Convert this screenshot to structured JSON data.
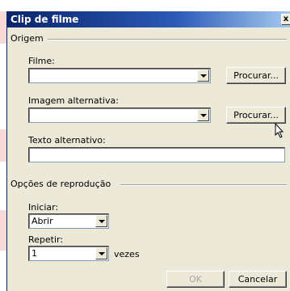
{
  "window": {
    "title": "Clip de filme",
    "close_glyph": "x"
  },
  "origem": {
    "group_label": "Origem",
    "filme_label": "Filme:",
    "filme_value": "",
    "procurar1_label": "Procurar...",
    "imagem_label": "Imagem alternativa:",
    "imagem_value": "",
    "procurar2_label": "Procurar...",
    "texto_label": "Texto alternativo:",
    "texto_value": ""
  },
  "reproducao": {
    "group_label": "Opções de reprodução",
    "iniciar_label": "Iniciar:",
    "iniciar_value": "Abrir",
    "repetir_label": "Repetir:",
    "repetir_value": "1",
    "vezes_label": "vezes"
  },
  "footer": {
    "ok_label": "OK",
    "cancel_label": "Cancelar"
  },
  "icons": {
    "close": "close-icon",
    "dropdown": "chevron-down-icon",
    "cursor": "mouse-pointer-icon"
  }
}
